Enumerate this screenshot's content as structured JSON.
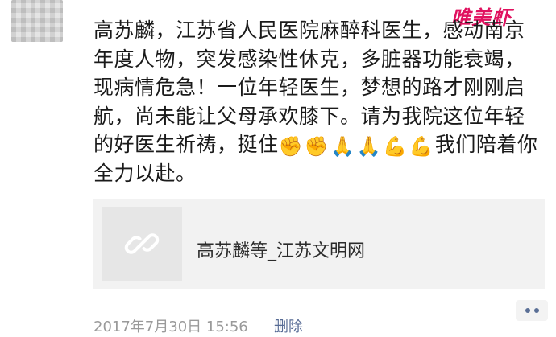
{
  "post": {
    "text_main": "高苏麟，江苏省人民医院麻醉科医生，感动南京年度人物，突发感染性休克，多脏器功能衰竭，现病情危急！一位年轻医生，梦想的路才刚刚启航，尚未能让父母承欢膝下。请为我院这位年轻的好医生祈祷，挺住",
    "emojis_inline": [
      "✊",
      "✊",
      "🙏",
      "🙏",
      "💪"
    ],
    "emoji_line2": "💪",
    "text_tail": "我们陪着你全力以赴。"
  },
  "link_card": {
    "title": "高苏麟等_江苏文明网",
    "thumb_icon": "link-icon"
  },
  "footer": {
    "timestamp": "2017年7月30日 15:56",
    "delete_label": "删除",
    "comment_icon": "more-dots-icon"
  },
  "watermark": {
    "text": "唯美虾"
  },
  "colors": {
    "link_blue": "#576b95",
    "watermark_pink": "#e0115f",
    "card_bg": "#f2f2f2"
  }
}
